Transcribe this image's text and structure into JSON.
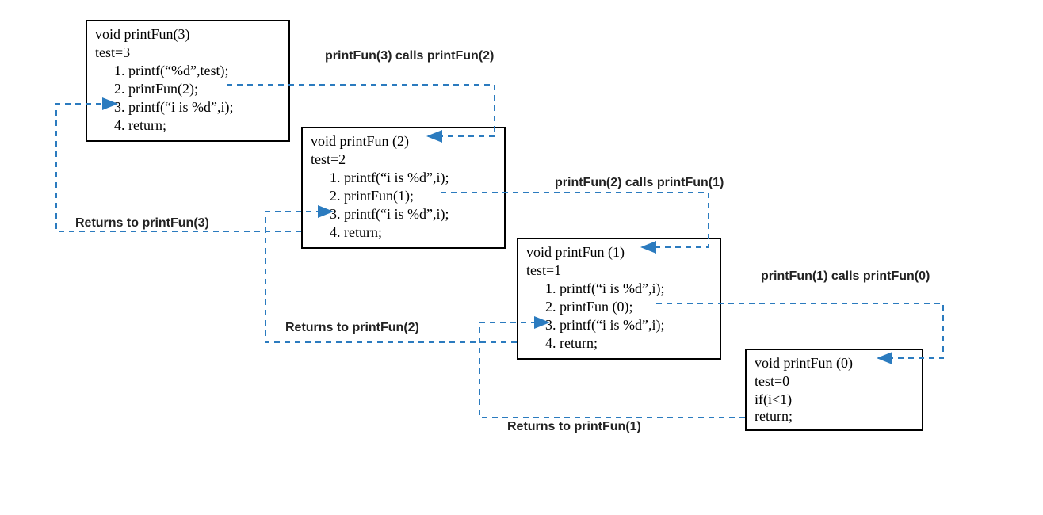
{
  "box3": {
    "sig": "void printFun(3)",
    "test": "test=3",
    "l1": "printf(“%d”,test);",
    "l2": "printFun(2);",
    "l3": "printf(“i is %d”,i);",
    "l4": "return;"
  },
  "box2": {
    "sig": "void printFun (2)",
    "test": "test=2",
    "l1": "printf(“i is %d”,i);",
    "l2": "printFun(1);",
    "l3": "printf(“i is %d”,i);",
    "l4": "return;"
  },
  "box1": {
    "sig": "void printFun (1)",
    "test": "test=1",
    "l1": "printf(“i is %d”,i);",
    "l2": "printFun (0);",
    "l3": "printf(“i is %d”,i);",
    "l4": "return;"
  },
  "box0": {
    "sig": "void printFun (0)",
    "test": "test=0",
    "cond": "if(i<1)",
    "ret": "return;"
  },
  "labels": {
    "call32": "printFun(3) calls printFun(2)",
    "call21": "printFun(2) calls printFun(1)",
    "call10": "printFun(1) calls printFun(0)",
    "ret3": "Returns to printFun(3)",
    "ret2": "Returns to printFun(2)",
    "ret1": "Returns to printFun(1)"
  }
}
